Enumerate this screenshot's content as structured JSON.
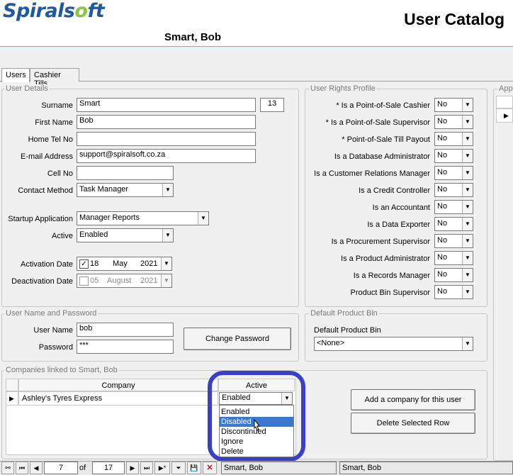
{
  "header": {
    "logo_main": "Spirals",
    "logo_o": "o",
    "logo_end": "ft",
    "title": "User Catalog",
    "user_name": "Smart, Bob"
  },
  "tabs": [
    "Users",
    "Cashier Tills"
  ],
  "user_details": {
    "legend": "User Details",
    "surname_label": "Surname",
    "surname_value": "Smart",
    "id_value": "13",
    "first_name_label": "First Name",
    "first_name_value": "Bob",
    "home_tel_label": "Home Tel No",
    "home_tel_value": "",
    "email_label": "E-mail Address",
    "email_value": "support@spiralsoft.co.za",
    "cell_label": "Cell No",
    "cell_value": "",
    "contact_method_label": "Contact Method",
    "contact_method_value": "Task Manager",
    "startup_app_label": "Startup Application",
    "startup_app_value": "Manager Reports",
    "active_label": "Active",
    "active_value": "Enabled",
    "activation_label": "Activation Date",
    "activation_checked": "✓",
    "activation_day": "18",
    "activation_month": "May",
    "activation_year": "2021",
    "deactivation_label": "Deactivation Date",
    "deactivation_day": "05",
    "deactivation_month": "August",
    "deactivation_year": "2021"
  },
  "rights": {
    "legend": "User Rights Profile",
    "items": [
      {
        "label": "* Is a Point-of-Sale Cashier",
        "value": "No"
      },
      {
        "label": "* Is a Point-of-Sale Supervisor",
        "value": "No"
      },
      {
        "label": "* Point-of-Sale Till Payout",
        "value": "No"
      },
      {
        "label": "Is a Database Administrator",
        "value": "No"
      },
      {
        "label": "Is a Customer Relations Manager",
        "value": "No"
      },
      {
        "label": "Is a Credit Controller",
        "value": "No"
      },
      {
        "label": "Is an Accountant",
        "value": "No"
      },
      {
        "label": "Is a Data Exporter",
        "value": "No"
      },
      {
        "label": "Is a Procurement Supervisor",
        "value": "No"
      },
      {
        "label": "Is a Product Administrator",
        "value": "No"
      },
      {
        "label": "Is a Records Manager",
        "value": "No"
      },
      {
        "label": "Product Bin Supervisor",
        "value": "No"
      }
    ]
  },
  "app_group": {
    "legend": "App"
  },
  "credentials": {
    "legend": "User Name and Password",
    "username_label": "User Name",
    "username_value": "bob",
    "password_label": "Password",
    "password_value": "***",
    "change_password_label": "Change Password"
  },
  "product_bin": {
    "legend": "Default Product Bin",
    "label": "Default Product Bin",
    "value": "<None>"
  },
  "companies": {
    "legend": "Companies linked to Smart, Bob",
    "col_company": "Company",
    "col_active": "Active",
    "row_company": "Ashley's Tyres Express",
    "row_active": "Enabled",
    "options": [
      "Enabled",
      "Disabled",
      "Discontinued",
      "Ignore",
      "Delete"
    ],
    "add_button": "Add a company for this user",
    "delete_button": "Delete Selected Row"
  },
  "navigator": {
    "current": "7",
    "of": "of",
    "total": "17",
    "status1": "Smart, Bob",
    "status2": "Smart, Bob"
  },
  "colors": {
    "logo_blue": "#1e5a9c",
    "logo_green": "#8cc63f",
    "selection": "#3a78d0",
    "highlight_ring": "#3a3fc8",
    "delete_red": "#d01010"
  }
}
